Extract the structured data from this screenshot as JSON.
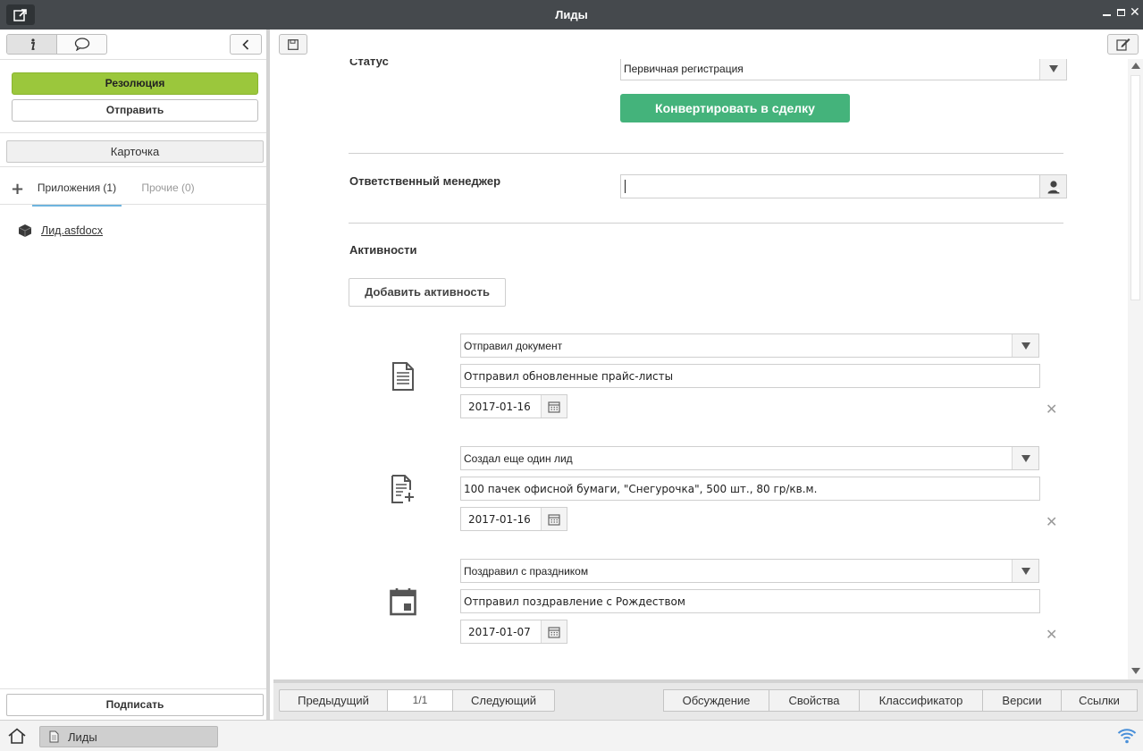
{
  "window": {
    "title": "Лиды"
  },
  "left_panel": {
    "resolution_label": "Резолюция",
    "send_label": "Отправить",
    "card_label": "Карточка",
    "tabs": {
      "attachments": "Приложения (1)",
      "other": "Прочие (0)"
    },
    "files": [
      {
        "name": "Лид.asfdocx"
      }
    ],
    "sign_label": "Подписать"
  },
  "form": {
    "status_label": "Статус",
    "status_value": "Первичная регистрация",
    "convert_label": "Конвертировать в сделку",
    "manager_label": "Ответственный менеджер",
    "manager_value": "",
    "activities_label": "Активности",
    "add_activity_label": "Добавить активность",
    "activities": [
      {
        "type": "Отправил документ",
        "description": "Отправил обновленные прайс-листы",
        "date": "2017-01-16",
        "icon": "document-icon"
      },
      {
        "type": "Создал еще один лид",
        "description": "100 пачек офисной бумаги, \"Снегурочка\", 500 шт., 80 гр/кв.м.",
        "date": "2017-01-16",
        "icon": "new-document-icon"
      },
      {
        "type": "Поздравил с праздником",
        "description": "Отправил поздравление с Рождеством",
        "date": "2017-01-07",
        "icon": "calendar-event-icon"
      }
    ]
  },
  "navigation": {
    "previous_label": "Предыдущий",
    "page_count": "1/1",
    "next_label": "Следующий",
    "tabs": [
      "Обсуждение",
      "Свойства",
      "Классификатор",
      "Версии",
      "Ссылки"
    ]
  },
  "taskbar": {
    "item_label": "Лиды"
  },
  "colors": {
    "resolution": "#9bc73c",
    "convert": "#44b37b",
    "titlebar": "#45494d"
  }
}
